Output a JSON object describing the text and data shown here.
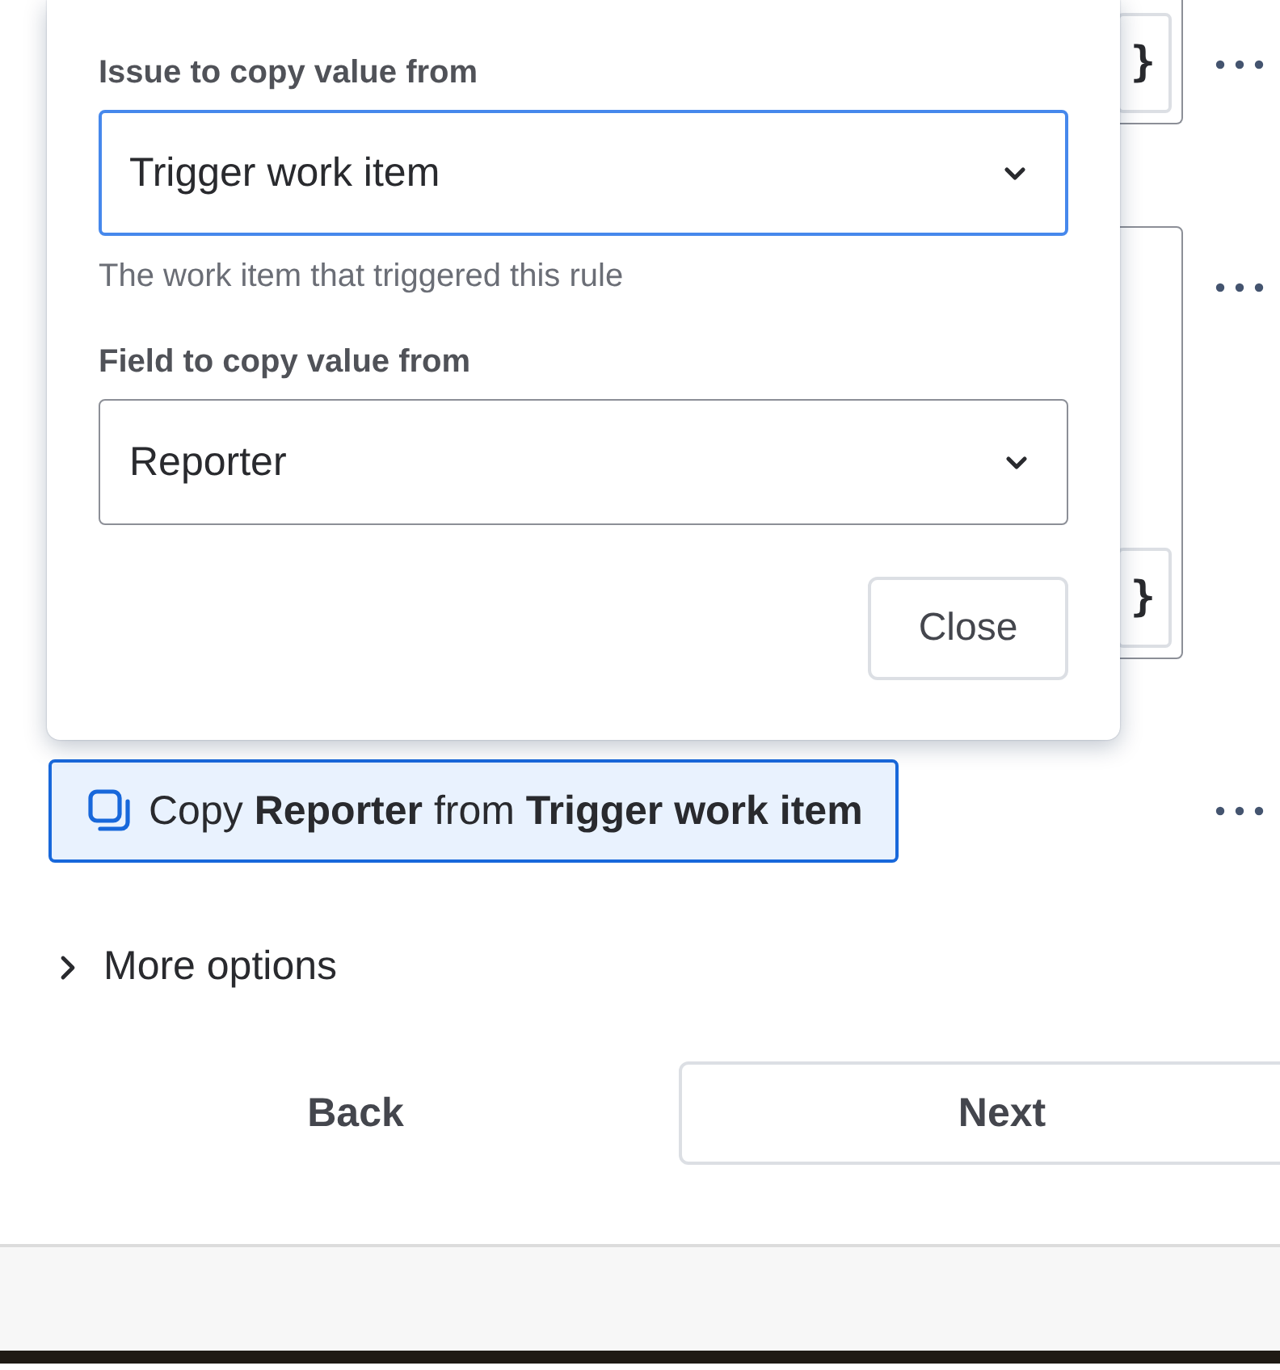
{
  "background_rows": [
    {
      "brace": "}"
    },
    {
      "brace": "}"
    }
  ],
  "popup": {
    "fields": [
      {
        "label": "Issue to copy value from",
        "value": "Trigger work item",
        "focused": true,
        "helper": "The work item that triggered this rule"
      },
      {
        "label": "Field to copy value from",
        "value": "Reporter",
        "focused": false
      }
    ],
    "close": "Close"
  },
  "action_chip": {
    "text": "Copy **Reporter** from **Trigger work item**",
    "selected": true
  },
  "more_options": {
    "label": "More options",
    "expanded": false
  },
  "buttons": [
    {
      "label": "Back",
      "kind": "subtle"
    },
    {
      "label": "Next",
      "kind": "outline"
    }
  ]
}
